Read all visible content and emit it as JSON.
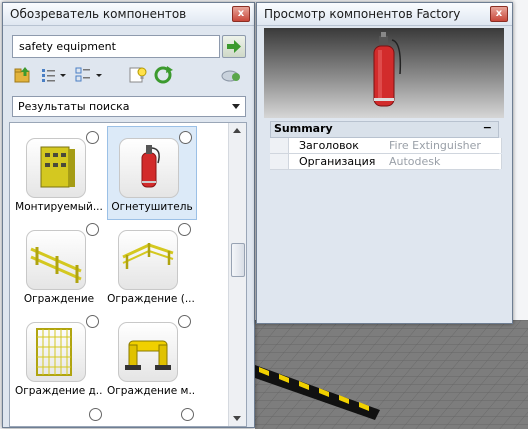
{
  "left_panel": {
    "title": "Обозреватель компонентов",
    "close": "x",
    "search": {
      "value": "safety equipment"
    },
    "toolbar": {
      "icons": [
        "folder-up-icon",
        "list-view-icon",
        "details-view-icon",
        "tips-icon",
        "refresh-icon",
        "cloud-icon"
      ]
    },
    "scope_dropdown": {
      "selected": "Результаты поиска"
    },
    "results": [
      {
        "label": "Монтируемый..."
      },
      {
        "label": "Огнетушитель"
      },
      {
        "label": "Ограждение"
      },
      {
        "label": "Ограждение (..."
      },
      {
        "label": "Ограждение д..."
      },
      {
        "label": "Ограждение м..."
      }
    ]
  },
  "right_panel": {
    "title": "Просмотр компонентов Factory",
    "close": "x",
    "summary": {
      "header": "Summary",
      "collapse": "−",
      "rows": [
        {
          "key": "Заголовок",
          "value": "Fire Extinguisher"
        },
        {
          "key": "Организация",
          "value": "Autodesk"
        }
      ]
    }
  },
  "colors": {
    "accent_red": "#d22b2b",
    "title_bar": "#dfe7f1",
    "selection": "#dceaf8",
    "hazard_yellow": "#f0d000"
  }
}
